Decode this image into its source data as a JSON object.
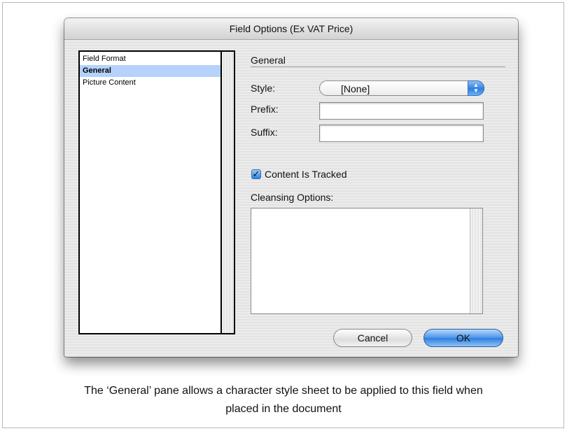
{
  "dialog": {
    "title": "Field Options (Ex VAT Price)"
  },
  "sidebar": {
    "items": [
      {
        "label": "Field Format",
        "selected": false
      },
      {
        "label": "General",
        "selected": true
      },
      {
        "label": "Picture Content",
        "selected": false
      }
    ]
  },
  "pane": {
    "section_title": "General",
    "style_label": "Style:",
    "style_value": "[None]",
    "prefix_label": "Prefix:",
    "prefix_value": "",
    "suffix_label": "Suffix:",
    "suffix_value": "",
    "tracked_checked": true,
    "tracked_label": "Content Is Tracked",
    "cleansing_label": "Cleansing Options:"
  },
  "buttons": {
    "cancel": "Cancel",
    "ok": "OK"
  },
  "caption": {
    "line1": "The ‘General’ pane allows a character style sheet to be applied to this field when",
    "line2": "placed in the document"
  },
  "colors": {
    "selection": "#b4d2fa",
    "accent": "#2f7de0"
  }
}
